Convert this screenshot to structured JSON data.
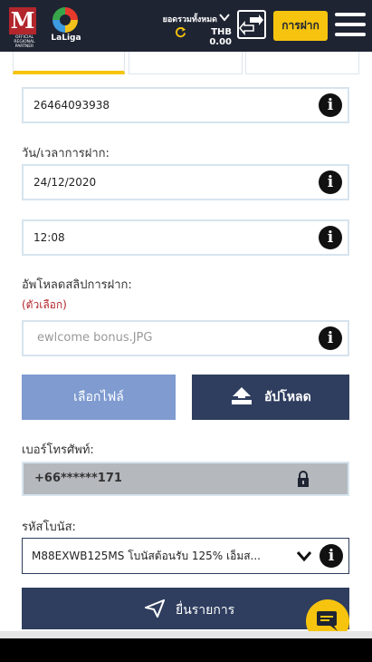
{
  "header": {
    "brand_caption": "OFFICIAL REGIONAL PARTNER",
    "laliga": "LaLiga",
    "balance_label": "ยอดรวมทั้งหมด",
    "balance_value": "THB 0.00",
    "deposit_label": "การฝาก"
  },
  "form": {
    "account_number": "26464093938",
    "datetime_label": "วัน/เวลาการฝาก:",
    "date_value": "24/12/2020",
    "time_value": "12:08",
    "upload_label": "อัพโหลดสลิปการฝาก:",
    "optional_label": "(ตัวเลือก)",
    "file_placeholder": "ewlcome bonus.JPG",
    "choose_file_label": "เลือกไฟล์",
    "upload_button_label": "อัปโหลด",
    "phone_label": "เบอร์โทรศัพท์:",
    "phone_value": "+66******171",
    "bonus_label": "รหัสโบนัส:",
    "bonus_value": "M88EXWB125MS โบนัสต้อนรับ 125% เอ็มส...",
    "submit_label": "ยื่นรายการ"
  },
  "colors": {
    "header_bg": "#1f2433",
    "accent_yellow": "#f6c40f",
    "primary_navy": "#2f3e5f",
    "choose_file_blue": "#7f9bd0"
  },
  "icons": [
    "info-icon",
    "refresh-icon",
    "transfer-icon",
    "menu-icon",
    "upload-icon",
    "lock-icon",
    "chevron-down-icon",
    "send-icon",
    "chat-icon"
  ]
}
